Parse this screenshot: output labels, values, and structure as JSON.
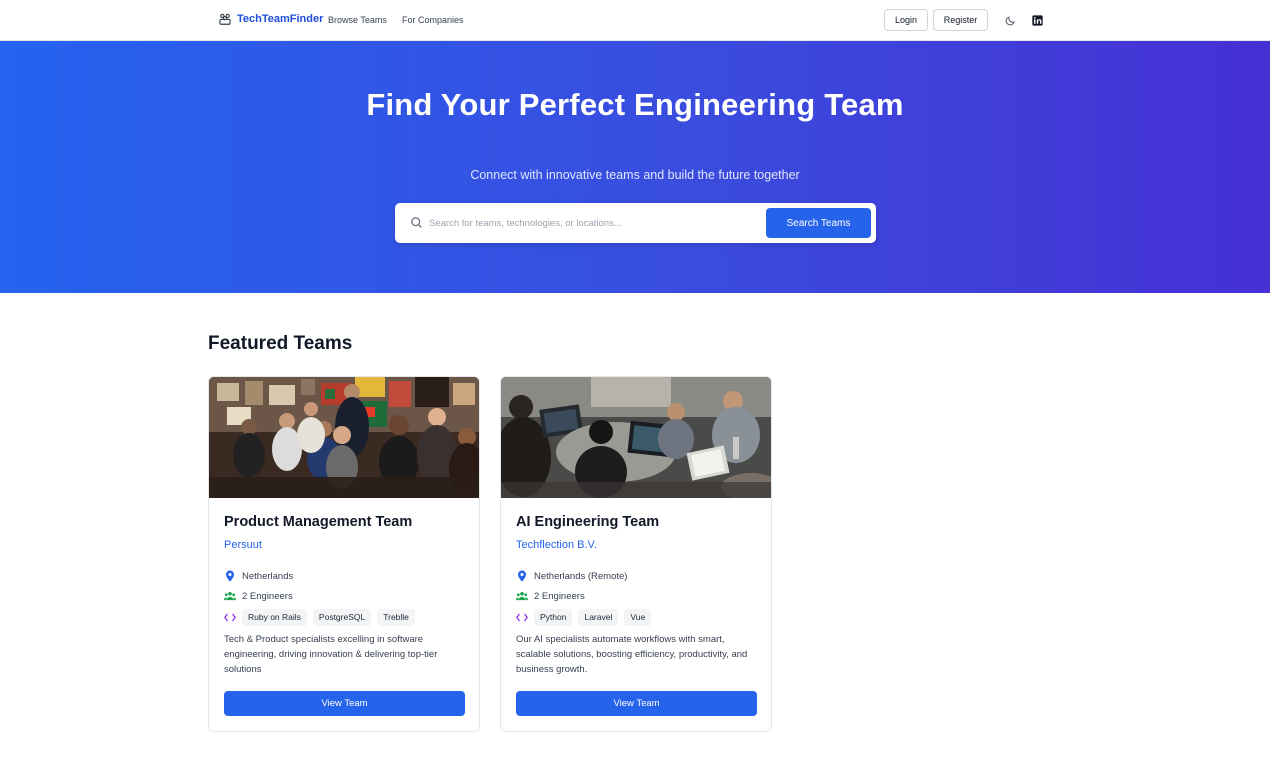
{
  "header": {
    "brand": "TechTeamFinder",
    "nav": [
      {
        "label": "Browse Teams"
      },
      {
        "label": "For Companies"
      }
    ],
    "login_label": "Login",
    "register_label": "Register",
    "icons": [
      "moon-icon",
      "linkedin-icon"
    ]
  },
  "hero": {
    "title": "Find Your Perfect Engineering Team",
    "subtitle": "Connect with innovative teams and build the future together",
    "search_placeholder": "Search for teams, technologies, or locations...",
    "search_button": "Search Teams"
  },
  "featured": {
    "title": "Featured Teams",
    "cards": [
      {
        "title": "Product Management Team",
        "company": "Persuut",
        "location": "Netherlands",
        "engineers": "2 Engineers",
        "tags": [
          "Ruby on Rails",
          "PostgreSQL",
          "Treblle"
        ],
        "description": "Tech & Product specialists excelling in software engineering, driving innovation & delivering top-tier solutions",
        "button": "View Team"
      },
      {
        "title": "AI Engineering Team",
        "company": "Techflection B.V.",
        "location": "Netherlands (Remote)",
        "engineers": "2 Engineers",
        "tags": [
          "Python",
          "Laravel",
          "Vue"
        ],
        "description": "Our AI specialists automate workflows with smart, scalable solutions, boosting efficiency, productivity, and business growth.",
        "button": "View Team"
      }
    ]
  },
  "colors": {
    "primary": "#2563eb",
    "hero_start": "#2563f0",
    "hero_end": "#4630d4",
    "location_icon": "#2563eb",
    "engineers_icon": "#16a34a",
    "code_icon": "#9333ea"
  }
}
